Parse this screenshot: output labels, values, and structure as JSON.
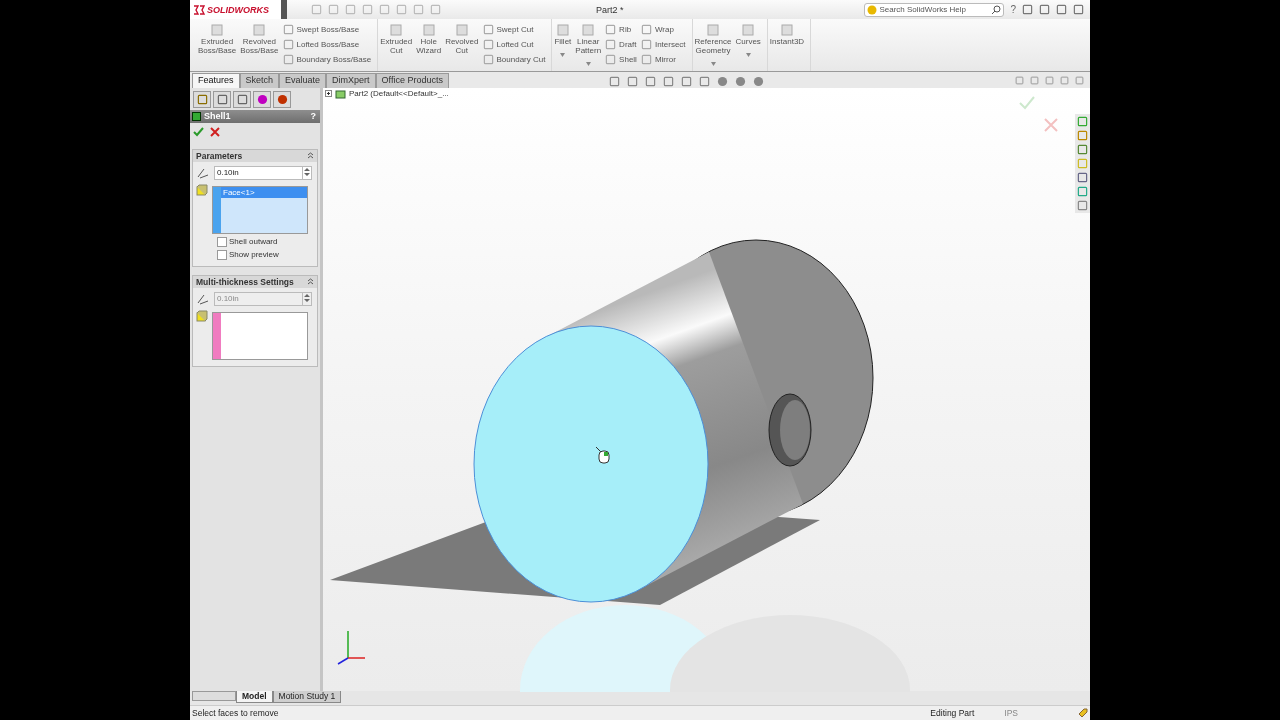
{
  "title_bar": {
    "logo": "SOLIDWORKS",
    "document_title": "Part2 *",
    "search": {
      "placeholder": "Search SolidWorks Help"
    },
    "help": "?"
  },
  "ribbon": [
    {
      "columns": [
        {
          "kind": "large",
          "label": "Extruded\nBoss/Base"
        },
        {
          "kind": "large",
          "label": "Revolved\nBoss/Base"
        },
        {
          "kind": "stack",
          "labels": [
            "Swept Boss/Base",
            "Lofted Boss/Base",
            "Boundary Boss/Base"
          ]
        }
      ]
    },
    {
      "columns": [
        {
          "kind": "large",
          "label": "Extruded\nCut"
        },
        {
          "kind": "large",
          "label": "Hole\nWizard"
        },
        {
          "kind": "large",
          "label": "Revolved\nCut"
        },
        {
          "kind": "stack",
          "labels": [
            "Swept Cut",
            "Lofted Cut",
            "Boundary Cut"
          ]
        }
      ]
    },
    {
      "columns": [
        {
          "kind": "large",
          "label": "Fillet",
          "dropdown": true
        },
        {
          "kind": "large",
          "label": "Linear\nPattern",
          "dropdown": true
        },
        {
          "kind": "stack",
          "labels": [
            "Rib",
            "Draft",
            "Shell"
          ]
        },
        {
          "kind": "stack",
          "labels": [
            "Wrap",
            "Intersect",
            "Mirror"
          ]
        }
      ]
    },
    {
      "columns": [
        {
          "kind": "large",
          "label": "Reference\nGeometry",
          "dropdown": true
        },
        {
          "kind": "large",
          "label": "Curves",
          "dropdown": true
        }
      ]
    },
    {
      "columns": [
        {
          "kind": "large",
          "label": "Instant3D"
        }
      ]
    }
  ],
  "command_tabs": [
    {
      "label": "Features",
      "selected": true
    },
    {
      "label": "Sketch",
      "selected": false
    },
    {
      "label": "Evaluate",
      "selected": false
    },
    {
      "label": "DimXpert",
      "selected": false
    },
    {
      "label": "Office Products",
      "selected": false
    }
  ],
  "property_manager": {
    "title": "Shell1",
    "help": "?",
    "sections": [
      {
        "title": "Parameters",
        "thickness": "0.10in",
        "disabled": false,
        "color": "#4aa3ee",
        "faces": [
          {
            "label": "Face<1>",
            "selected": true
          }
        ],
        "options": [
          {
            "label": "Shell outward",
            "checked": false
          },
          {
            "label": "Show preview",
            "checked": false
          }
        ]
      },
      {
        "title": "Multi-thickness Settings",
        "thickness": "0.10in",
        "disabled": true,
        "color": "#f07cc0"
      }
    ]
  },
  "viewport": {
    "tree_item": "Part2  (Default<<Default>_..."
  },
  "bottom_tabs": [
    {
      "label": "Model",
      "selected": true
    },
    {
      "label": "Motion Study 1",
      "selected": false
    }
  ],
  "status_bar": {
    "message": "Select faces to remove",
    "mode": "Editing Part",
    "units": "IPS"
  }
}
